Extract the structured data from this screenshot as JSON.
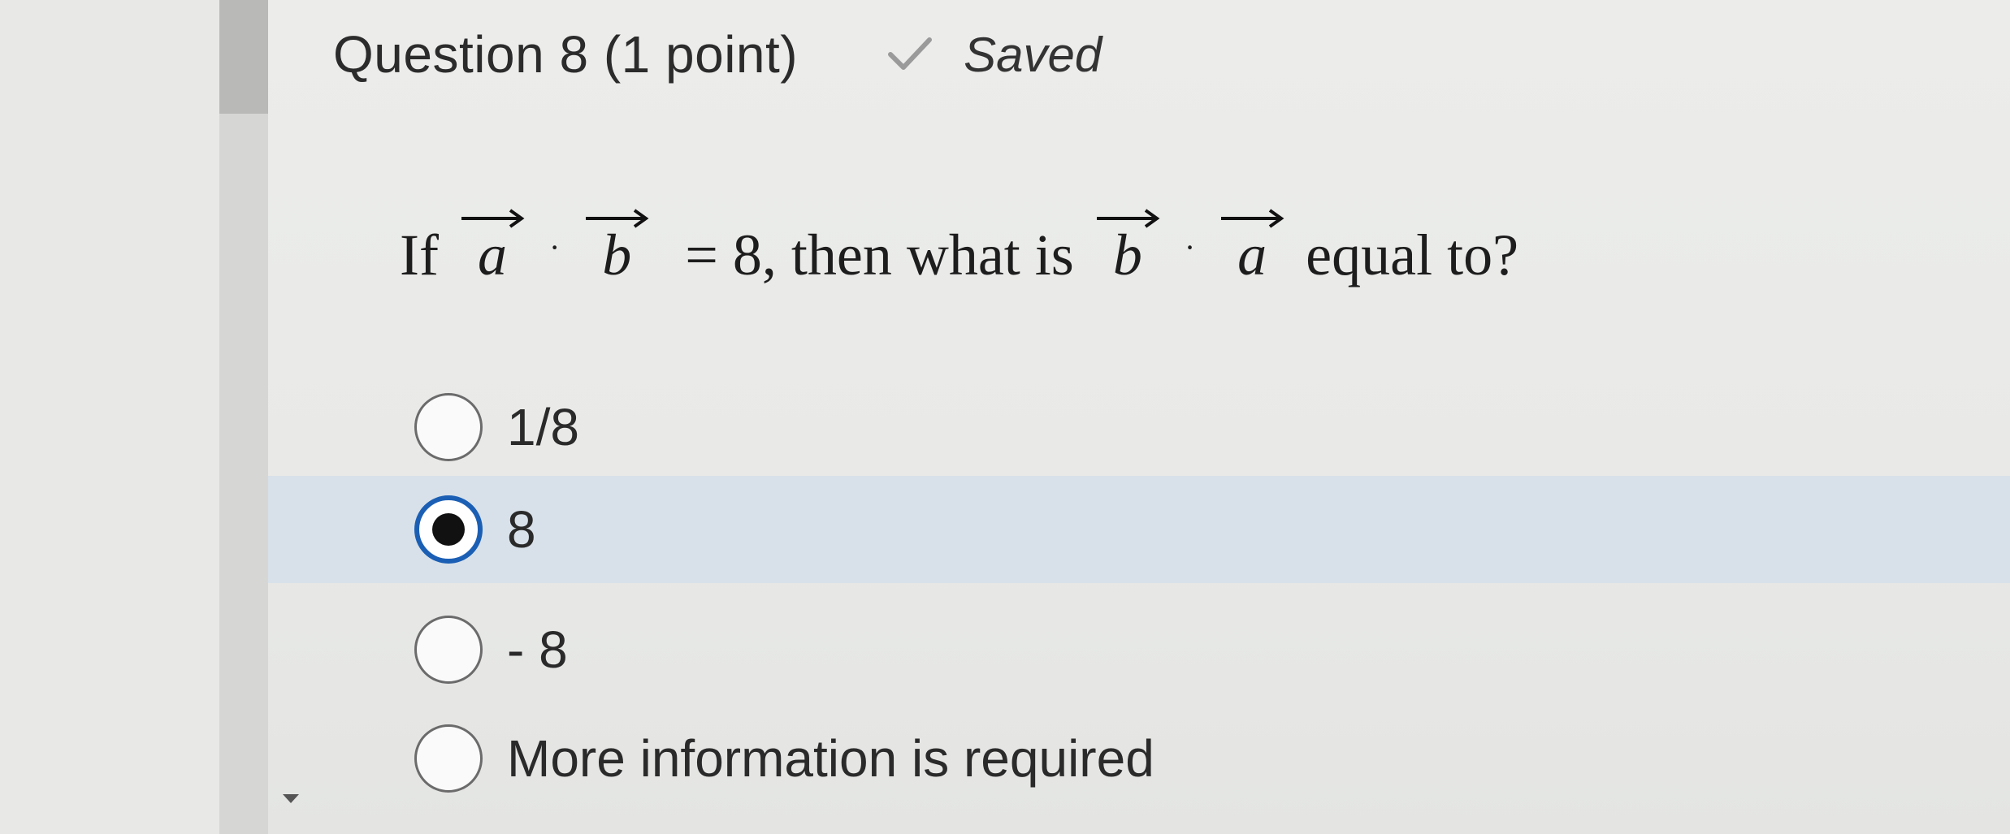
{
  "question": {
    "title": "Question 8 (1 point)",
    "status": "Saved",
    "status_icon": "check-icon",
    "prompt": {
      "prefix": "If",
      "vector_1": "a",
      "operator": "·",
      "vector_2": "b",
      "middle": "= 8, then what is",
      "vector_3": "b",
      "vector_4": "a",
      "suffix": "equal to?"
    }
  },
  "options": [
    {
      "label": "1/8",
      "selected": false
    },
    {
      "label": "8",
      "selected": true
    },
    {
      "label": "- 8",
      "selected": false
    },
    {
      "label": "More information is required",
      "selected": false
    }
  ],
  "colors": {
    "selected_row": "#d8e1e9",
    "radio_checked": "#1b5fb5"
  }
}
